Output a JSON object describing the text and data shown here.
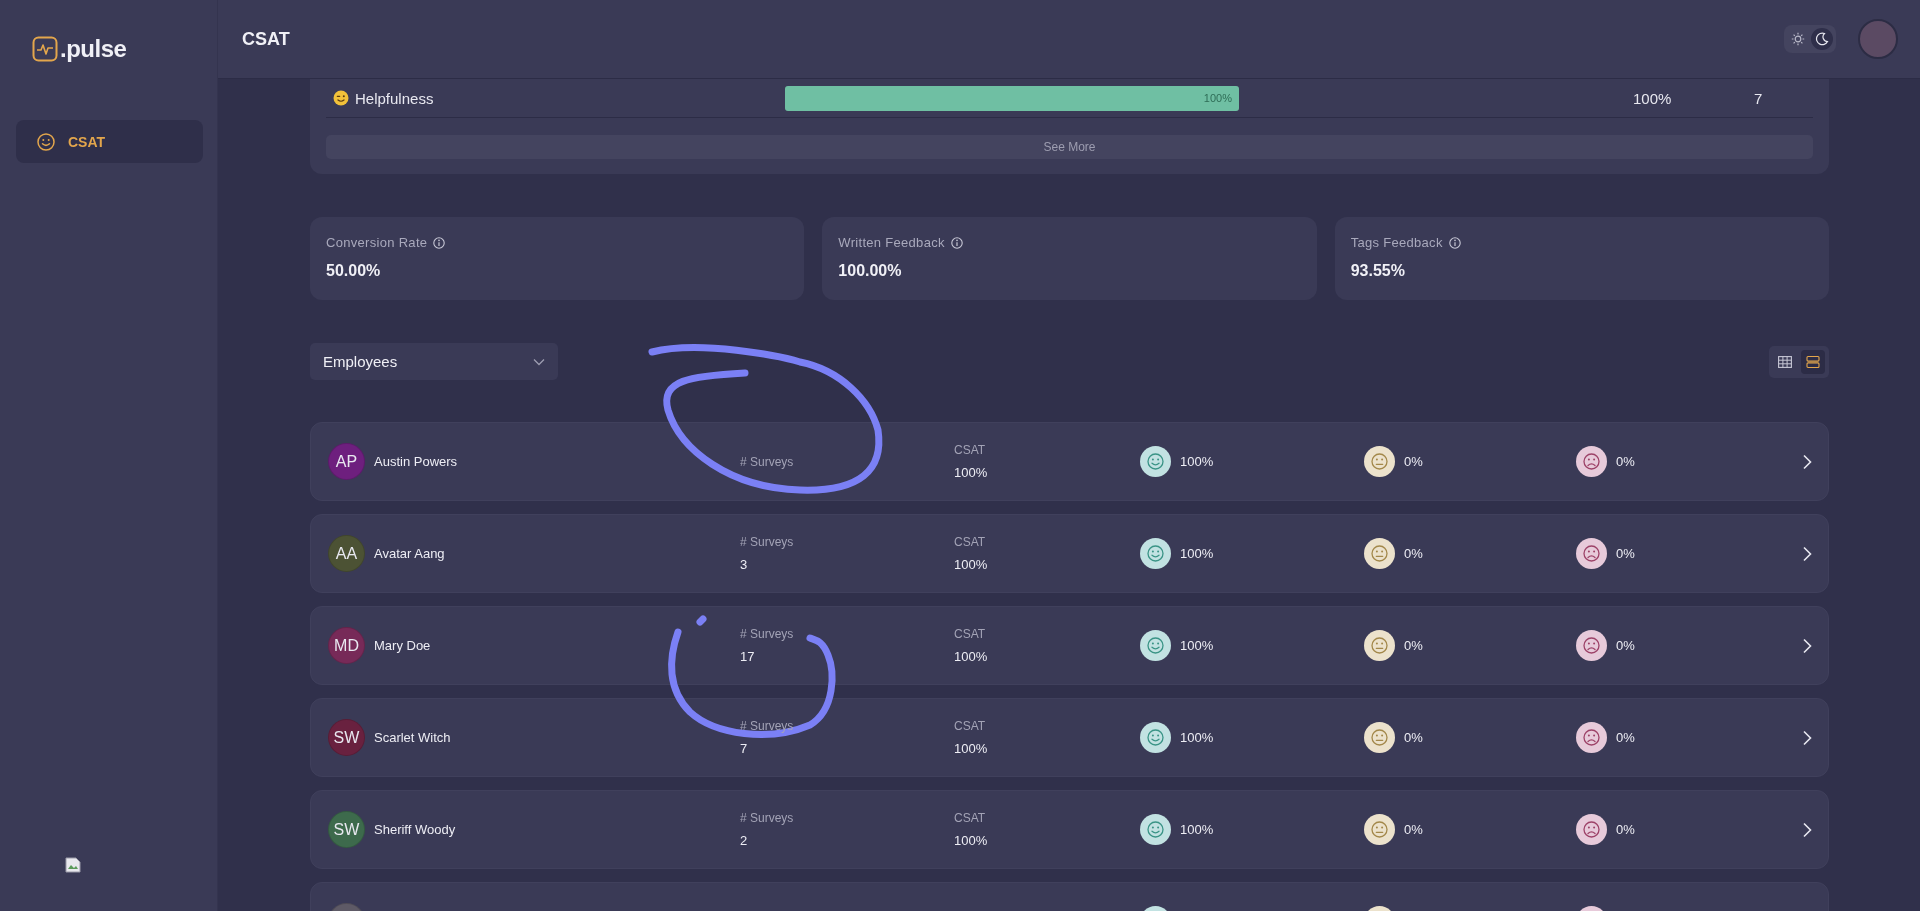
{
  "sidebar": {
    "logo": ".pulse",
    "items": [
      {
        "label": "CSAT",
        "selected": true
      }
    ]
  },
  "header": {
    "title": "CSAT",
    "theme_toggle": [
      {
        "kind": "sun",
        "selected": false
      },
      {
        "kind": "moon",
        "selected": true
      }
    ]
  },
  "ratings": {
    "rows": [
      {
        "label": "Helpfulness",
        "level": 1,
        "bar_label": "100%",
        "percent": "100%",
        "count": "7"
      }
    ],
    "see_more": "See More"
  },
  "metrics": [
    {
      "label": "Conversion Rate",
      "value": "50.00%"
    },
    {
      "label": "Written Feedback",
      "value": "100.00%"
    },
    {
      "label": "Tags Feedback",
      "value": "93.55%"
    }
  ],
  "filter": {
    "value": "Employees"
  },
  "view_toggle": [
    {
      "kind": "table",
      "selected": false
    },
    {
      "kind": "list",
      "selected": true
    }
  ],
  "employees": [
    {
      "initials": "AP",
      "name": "Austin Powers",
      "color": "#6e1f7e",
      "surveys_label": "# Surveys",
      "csat_label": "CSAT",
      "csat": "100%",
      "positive": "100%",
      "neutral": "0%",
      "negative": "0%"
    },
    {
      "initials": "AA",
      "name": "Avatar Aang",
      "color": "#4c5234",
      "surveys_label": "# Surveys",
      "surveys": "3",
      "csat_label": "CSAT",
      "csat": "100%",
      "positive": "100%",
      "neutral": "0%",
      "negative": "0%"
    },
    {
      "initials": "MD",
      "name": "Mary Doe",
      "color": "#772a58",
      "surveys_label": "# Surveys",
      "surveys": "17",
      "csat_label": "CSAT",
      "csat": "100%",
      "positive": "100%",
      "neutral": "0%",
      "negative": "0%"
    },
    {
      "initials": "SW",
      "name": "Scarlet Witch",
      "color": "#69213f",
      "surveys_label": "# Surveys",
      "surveys": "7",
      "csat_label": "CSAT",
      "csat": "100%",
      "positive": "100%",
      "neutral": "0%",
      "negative": "0%"
    },
    {
      "initials": "SW",
      "name": "Sheriff Woody",
      "color": "#3d6a4c",
      "surveys_label": "# Surveys",
      "surveys": "2",
      "csat_label": "CSAT",
      "csat": "100%",
      "positive": "100%",
      "neutral": "0%",
      "negative": "0%"
    },
    {
      "color": "#5e5a66"
    }
  ]
}
